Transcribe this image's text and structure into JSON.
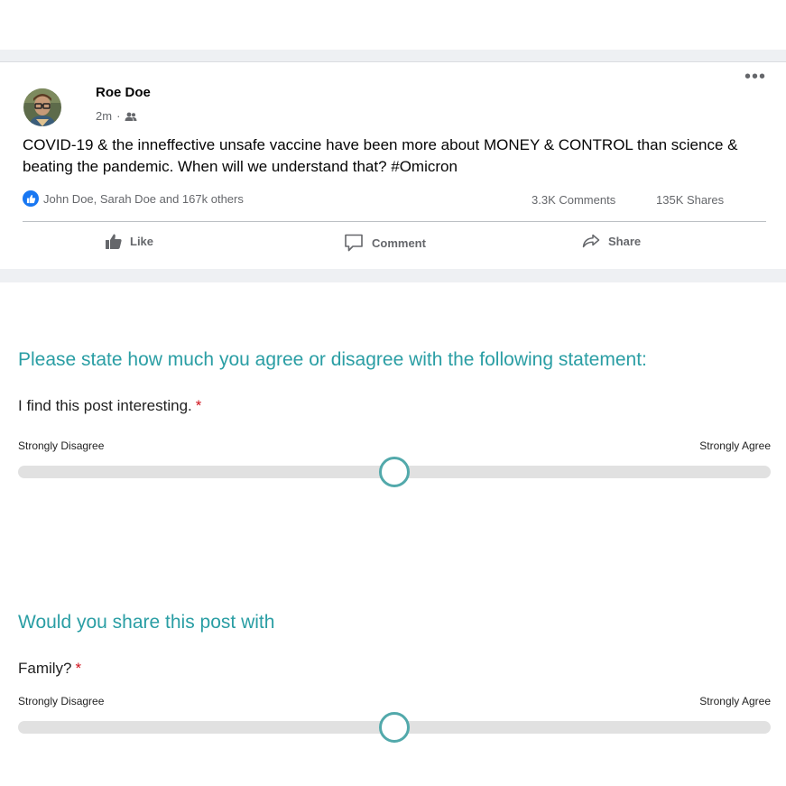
{
  "post": {
    "author": "Roe Doe",
    "time": "2m",
    "separator": "·",
    "audience_icon": "friends-icon",
    "text": "COVID-19 & the inneffective unsafe vaccine have been more about MONEY & CONTROL than science & beating the pandemic. When will we understand that? #Omicron",
    "reactions_text": "John Doe, Sarah Doe and 167k others",
    "comments_count": "3.3K Comments",
    "shares_count": "135K Shares",
    "more_label": "•••",
    "actions": {
      "like": "Like",
      "comment": "Comment",
      "share": "Share"
    },
    "accent_color": "#1877f2"
  },
  "survey": {
    "accent_color": "#2a9ea4",
    "q1": {
      "title": "Please state how much you agree or disagree with the following statement:",
      "question": "I find this post interesting.",
      "required_marker": "*",
      "left_label": "Strongly Disagree",
      "right_label": "Strongly Agree",
      "slider_value_fraction": 0.5
    },
    "q2": {
      "title": "Would you share this post with",
      "question": "Family?",
      "required_marker": "*",
      "left_label": "Strongly Disagree",
      "right_label": "Strongly Agree",
      "slider_value_fraction": 0.5
    }
  }
}
